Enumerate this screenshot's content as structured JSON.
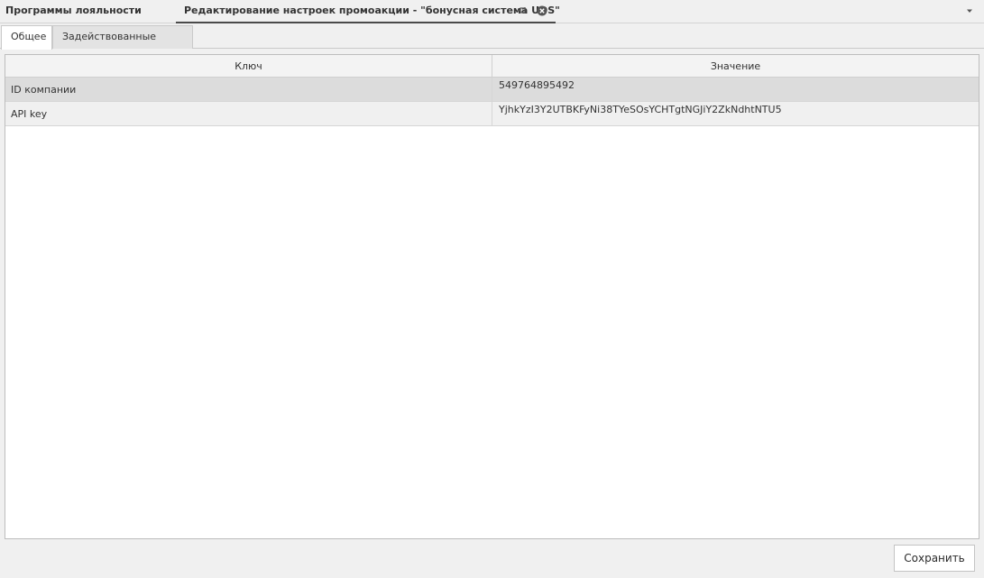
{
  "window": {
    "tabs": [
      {
        "label": "Программы лояльности"
      },
      {
        "label": "Редактирование настроек промоакции - \"бонусная система UDS\""
      }
    ]
  },
  "subtabs": [
    {
      "label": "Общее",
      "active": true
    },
    {
      "label": "Задействованные склады",
      "active": false
    }
  ],
  "grid": {
    "columns": [
      "Ключ",
      "Значение"
    ],
    "rows": [
      {
        "key": "ID компании",
        "value": "549764895492"
      },
      {
        "key": "API key",
        "value": "YjhkYzI3Y2UTBKFyNi38TYeSOsYCHTgtNGJiY2ZkNdhtNTU5"
      }
    ]
  },
  "footer": {
    "save_label": "Сохранить"
  },
  "icons": {
    "pin": "pin-icon",
    "close": "close-icon",
    "dropdown": "chevron-down-icon"
  }
}
